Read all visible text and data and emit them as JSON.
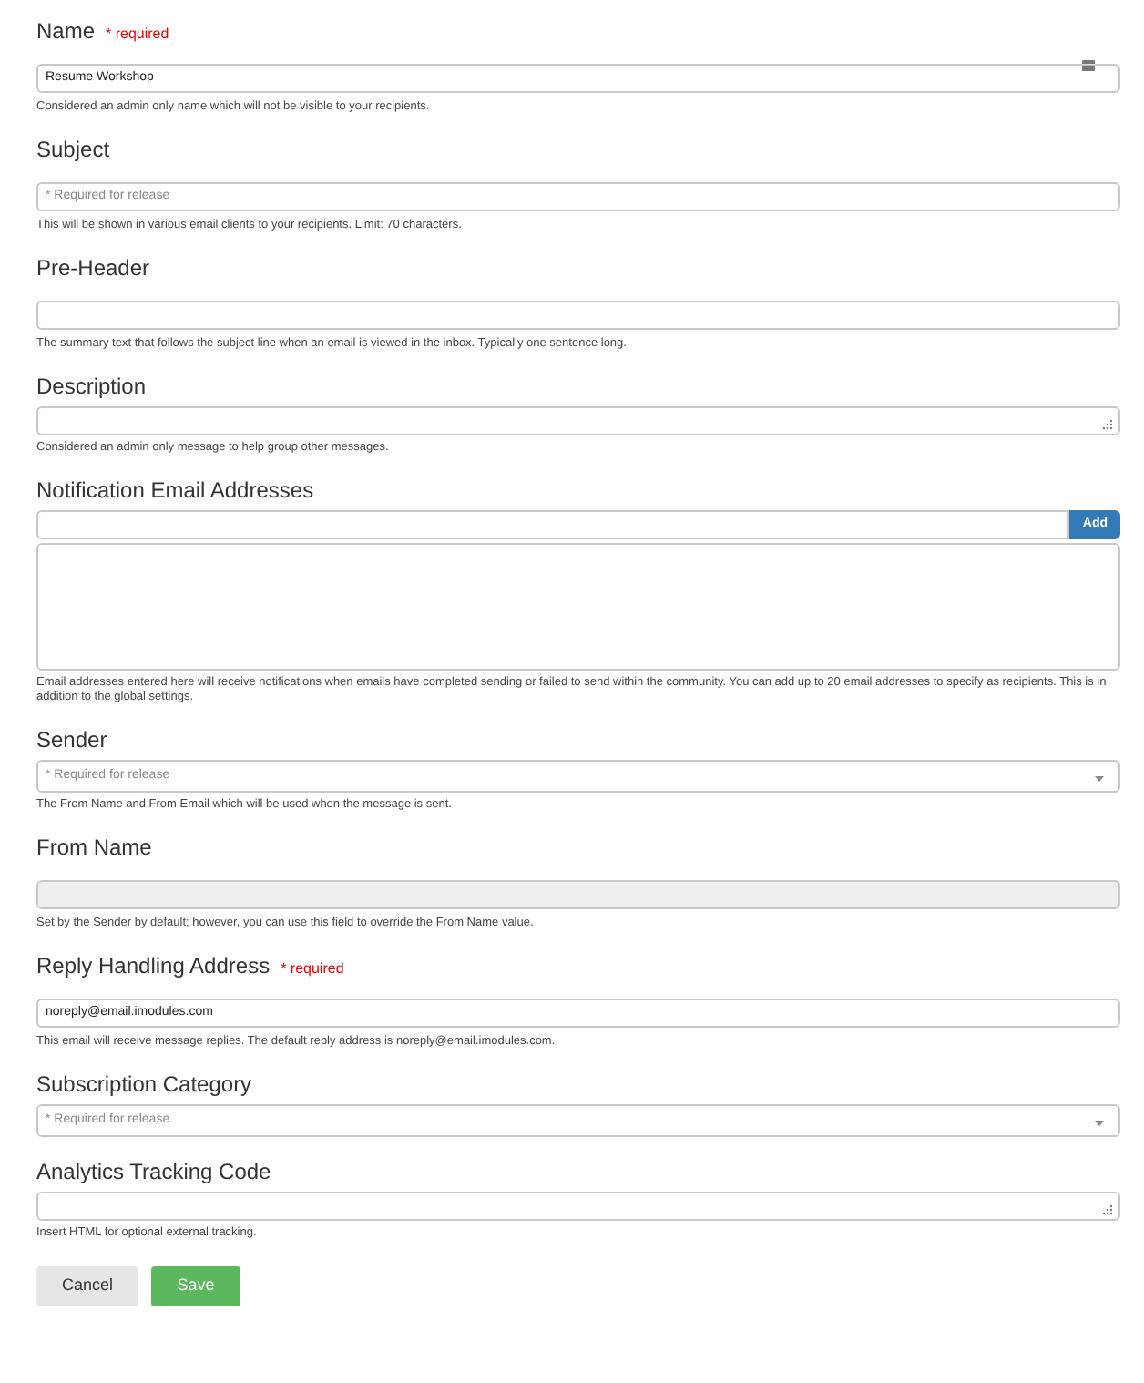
{
  "fields": [
    {
      "kind": "text",
      "label": "Name",
      "required": "* required",
      "value": "Resume Workshop",
      "icon": true,
      "hint": "Considered an admin only name which will not be visible to your recipients."
    },
    {
      "kind": "text",
      "label": "Subject",
      "placeholder": "* Required for release",
      "hint": "This will be shown in various email clients to your recipients. Limit: 70 characters."
    },
    {
      "kind": "text",
      "label": "Pre-Header",
      "hint": "The summary text that follows the subject line when an email is viewed in the inbox. Typically one sentence long."
    },
    {
      "kind": "textarea",
      "label": "Description",
      "hint": "Considered an admin only message to help group other messages."
    },
    {
      "kind": "email_list",
      "label": "Notification Email Addresses",
      "button": "Add",
      "hint": "Email addresses entered here will receive notifications when emails have completed sending or failed to send within the community. You can add up to 20 email addresses to specify as recipients. This is in addition to the global settings."
    },
    {
      "kind": "select",
      "label": "Sender",
      "placeholder": "* Required for release",
      "hint": "The From Name and From Email which will be used when the message is sent."
    },
    {
      "kind": "text",
      "label": "From Name",
      "disabled": true,
      "hint": "Set by the Sender by default; however, you can use this field to override the From Name value."
    },
    {
      "kind": "text",
      "label": "Reply Handling Address",
      "required": "* required",
      "value": "noreply@email.imodules.com",
      "hint": "This email will receive message replies. The default reply address is noreply@email.imodules.com."
    },
    {
      "kind": "select",
      "label": "Subscription Category",
      "placeholder": "* Required for release"
    },
    {
      "kind": "textarea",
      "label": "Analytics Tracking Code",
      "hint": "Insert HTML for optional external tracking."
    }
  ],
  "buttons": [
    {
      "kind": "secondary",
      "label": "Cancel"
    },
    {
      "kind": "primary",
      "label": "Save"
    }
  ]
}
